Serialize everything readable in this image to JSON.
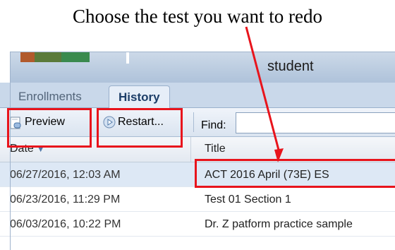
{
  "annotation": {
    "caption": "Choose the test you want to redo"
  },
  "window": {
    "title": "student"
  },
  "tabs": [
    {
      "label": "Enrollments"
    },
    {
      "label": "History"
    }
  ],
  "toolbar": {
    "preview_label": "Preview",
    "restart_label": "Restart...",
    "find_label": "Find:",
    "find_value": ""
  },
  "table": {
    "columns": [
      "Date",
      "Title"
    ],
    "rows": [
      {
        "date": "06/27/2016, 12:03 AM",
        "title": "ACT 2016 April (73E) ES"
      },
      {
        "date": "06/23/2016, 11:29 PM",
        "title": "Test 01 Section 1"
      },
      {
        "date": "06/03/2016, 10:22 PM",
        "title": "Dr. Z patform practice sample"
      }
    ]
  },
  "colors": {
    "highlight": "#e8141c",
    "accent": "#1d3e68",
    "tab_bg": "#c9d8ea"
  }
}
